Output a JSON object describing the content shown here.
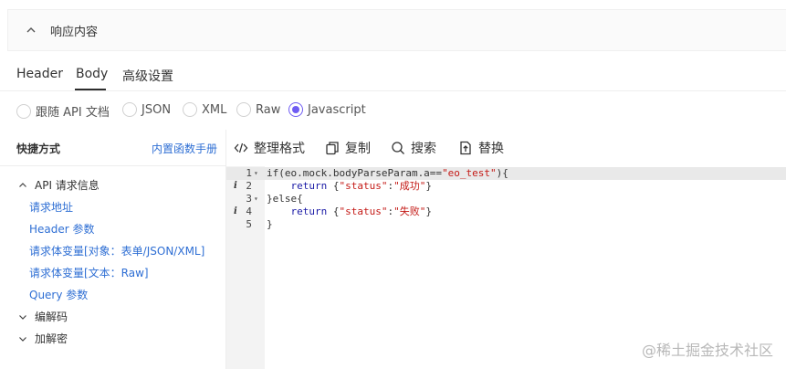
{
  "section": {
    "title": "响应内容"
  },
  "tabs": [
    {
      "label": "Header"
    },
    {
      "label": "Body"
    },
    {
      "label": "高级设置"
    }
  ],
  "active_tab": "Body",
  "body_types": [
    {
      "label": "跟随 API 文档",
      "checked": false
    },
    {
      "label": "JSON",
      "checked": false
    },
    {
      "label": "XML",
      "checked": false
    },
    {
      "label": "Raw",
      "checked": false
    },
    {
      "label": "Javascript",
      "checked": true
    }
  ],
  "sidebar": {
    "title": "快捷方式",
    "link": "内置函数手册",
    "groups": [
      {
        "label": "API 请求信息",
        "expanded": true,
        "items": [
          "请求地址",
          "Header 参数",
          "请求体变量[对象：表单/JSON/XML]",
          "请求体变量[文本：Raw]",
          "Query 参数"
        ]
      },
      {
        "label": "编解码",
        "expanded": false
      },
      {
        "label": "加解密",
        "expanded": false
      }
    ]
  },
  "toolbar": {
    "format": "整理格式",
    "copy": "复制",
    "search": "搜索",
    "replace": "替换"
  },
  "editor": {
    "lines": [
      {
        "num": "1",
        "info": "",
        "fold": "▾",
        "parts": [
          [
            "ident",
            "if(eo.mock.bodyParseParam.a=="
          ],
          [
            "str",
            "\"eo_test\""
          ],
          [
            "ident",
            "){"
          ]
        ]
      },
      {
        "num": "2",
        "info": "i",
        "fold": "",
        "parts": [
          [
            "ident",
            "    "
          ],
          [
            "kw",
            "return"
          ],
          [
            "ident",
            " {"
          ],
          [
            "str",
            "\"status\""
          ],
          [
            "ident",
            ":"
          ],
          [
            "str",
            "\"成功\""
          ],
          [
            "ident",
            "}"
          ]
        ]
      },
      {
        "num": "3",
        "info": "",
        "fold": "▾",
        "parts": [
          [
            "ident",
            "}else{"
          ]
        ]
      },
      {
        "num": "4",
        "info": "i",
        "fold": "",
        "parts": [
          [
            "ident",
            "    "
          ],
          [
            "kw",
            "return"
          ],
          [
            "ident",
            " {"
          ],
          [
            "str",
            "\"status\""
          ],
          [
            "ident",
            ":"
          ],
          [
            "str",
            "\"失败\""
          ],
          [
            "ident",
            "}"
          ]
        ]
      },
      {
        "num": "5",
        "info": "",
        "fold": "",
        "parts": [
          [
            "ident",
            "}"
          ]
        ]
      }
    ]
  },
  "colors": {
    "accent": "#6f5cf3",
    "link": "#2f6fd4",
    "string": "#c41a16",
    "keyword": "#1a1aa6"
  },
  "watermark": "@稀土掘金技术社区"
}
